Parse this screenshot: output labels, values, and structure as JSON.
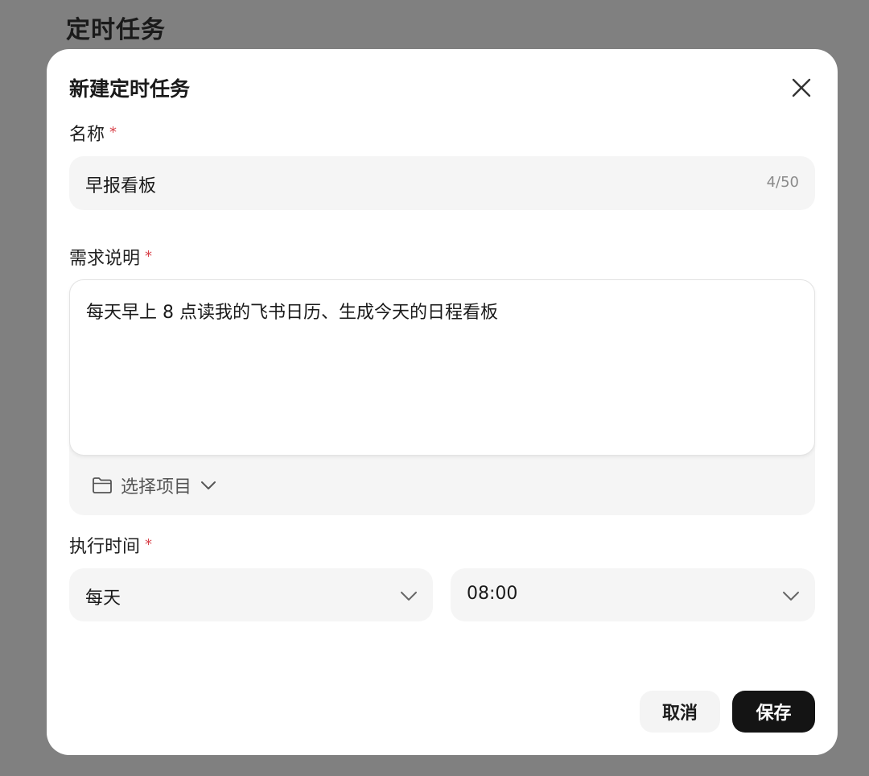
{
  "page": {
    "title": "定时任务"
  },
  "modal": {
    "title": "新建定时任务",
    "name_field": {
      "label": "名称",
      "required_mark": "*",
      "value": "早报看板",
      "char_count": "4/50"
    },
    "description_field": {
      "label": "需求说明",
      "required_mark": "*",
      "value": "每天早上 8 点读我的飞书日历、生成今天的日程看板",
      "project_select_label": "选择项目"
    },
    "schedule_field": {
      "label": "执行时间",
      "required_mark": "*",
      "frequency": "每天",
      "time": "08:00"
    },
    "buttons": {
      "cancel": "取消",
      "save": "保存"
    }
  },
  "colors": {
    "overlay": "#808080",
    "required": "#d8434b",
    "primary_button": "#141414"
  }
}
